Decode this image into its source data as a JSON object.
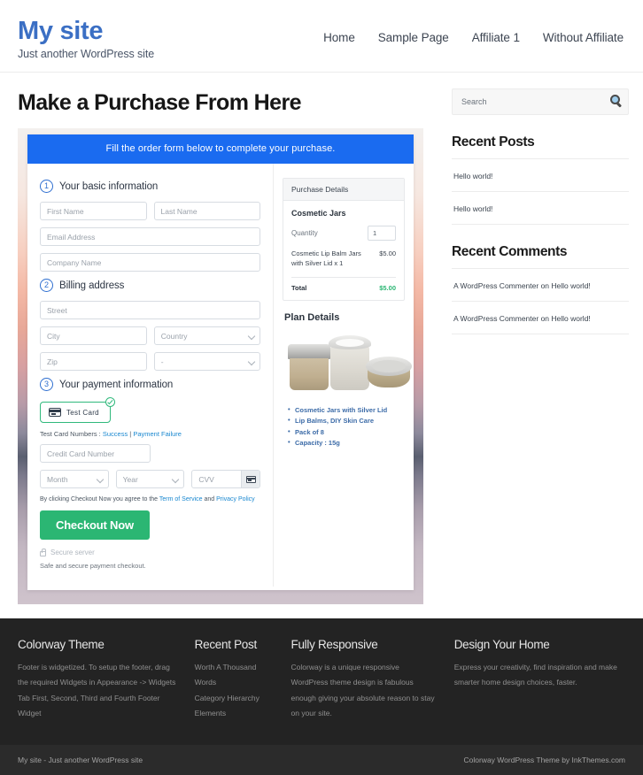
{
  "header": {
    "site_title": "My site",
    "tagline": "Just another WordPress site",
    "nav": [
      {
        "label": "Home"
      },
      {
        "label": "Sample Page"
      },
      {
        "label": "Affiliate 1"
      },
      {
        "label": "Without Affiliate"
      }
    ]
  },
  "main": {
    "page_title": "Make a Purchase From Here",
    "banner": "Fill the order form below to complete your purchase.",
    "steps": {
      "one_num": "1",
      "one_label": "Your basic information",
      "two_num": "2",
      "two_label": "Billing address",
      "three_num": "3",
      "three_label": "Your payment information"
    },
    "fields": {
      "first_name": "First Name",
      "last_name": "Last Name",
      "email": "Email Address",
      "company": "Company Name",
      "street": "Street",
      "city": "City",
      "country": "Country",
      "zip": "Zip",
      "state": "-",
      "card_number": "Credit Card Number",
      "month": "Month",
      "year": "Year",
      "cvv": "CVV"
    },
    "payment": {
      "test_card_label": "Test  Card",
      "test_numbers_prefix": "Test Card Numbers : ",
      "success_link": "Success",
      "separator": " | ",
      "failure_link": "Payment Failure",
      "terms_prefix": "By clicking Checkout Now you agree to the ",
      "terms_link": "Term of Service",
      "terms_mid": " and ",
      "privacy_link": "Privacy Policy",
      "checkout_button": "Checkout Now",
      "secure_server": "Secure server",
      "safe_text": "Safe and secure payment checkout."
    },
    "summary": {
      "head": "Purchase Details",
      "product": "Cosmetic Jars",
      "quantity_label": "Quantity",
      "quantity_value": "1",
      "line_name": "Cosmetic Lip Balm Jars with Silver Lid x 1",
      "line_price": "$5.00",
      "total_label": "Total",
      "total_value": "$5.00"
    },
    "plan": {
      "title": "Plan Details",
      "features": [
        "Cosmetic Jars with Silver Lid",
        "Lip Balms, DIY Skin Care",
        "Pack of 8",
        "Capacity : 15g"
      ]
    }
  },
  "sidebar": {
    "search_placeholder": "Search",
    "recent_posts": {
      "title": "Recent Posts",
      "items": [
        "Hello world!",
        "Hello world!"
      ]
    },
    "recent_comments": {
      "title": "Recent Comments",
      "items": [
        "A WordPress Commenter on Hello world!",
        "A WordPress Commenter on Hello world!"
      ]
    }
  },
  "footer": {
    "columns": [
      {
        "title": "Colorway Theme",
        "text": "Footer is widgetized. To setup the footer, drag the required Widgets in Appearance -> Widgets Tab First, Second, Third and Fourth Footer Widget"
      },
      {
        "title": "Recent Post",
        "items": [
          "Worth A Thousand Words",
          "Category Hierarchy",
          "Elements"
        ]
      },
      {
        "title": "Fully Responsive",
        "text": "Colorway is a unique responsive WordPress theme design is fabulous enough giving your absolute reason to stay on your site."
      },
      {
        "title": "Design Your Home",
        "text": "Express your creativity, find inspiration and make smarter home design choices, faster."
      }
    ],
    "bottom_left": "My site - Just another WordPress site",
    "bottom_right": "Colorway WordPress Theme by InkThemes.com"
  },
  "colors": {
    "brand_blue": "#3b6fc4",
    "banner_blue": "#1a6bf0",
    "green": "#2bb673",
    "footer_bg": "#232323"
  }
}
